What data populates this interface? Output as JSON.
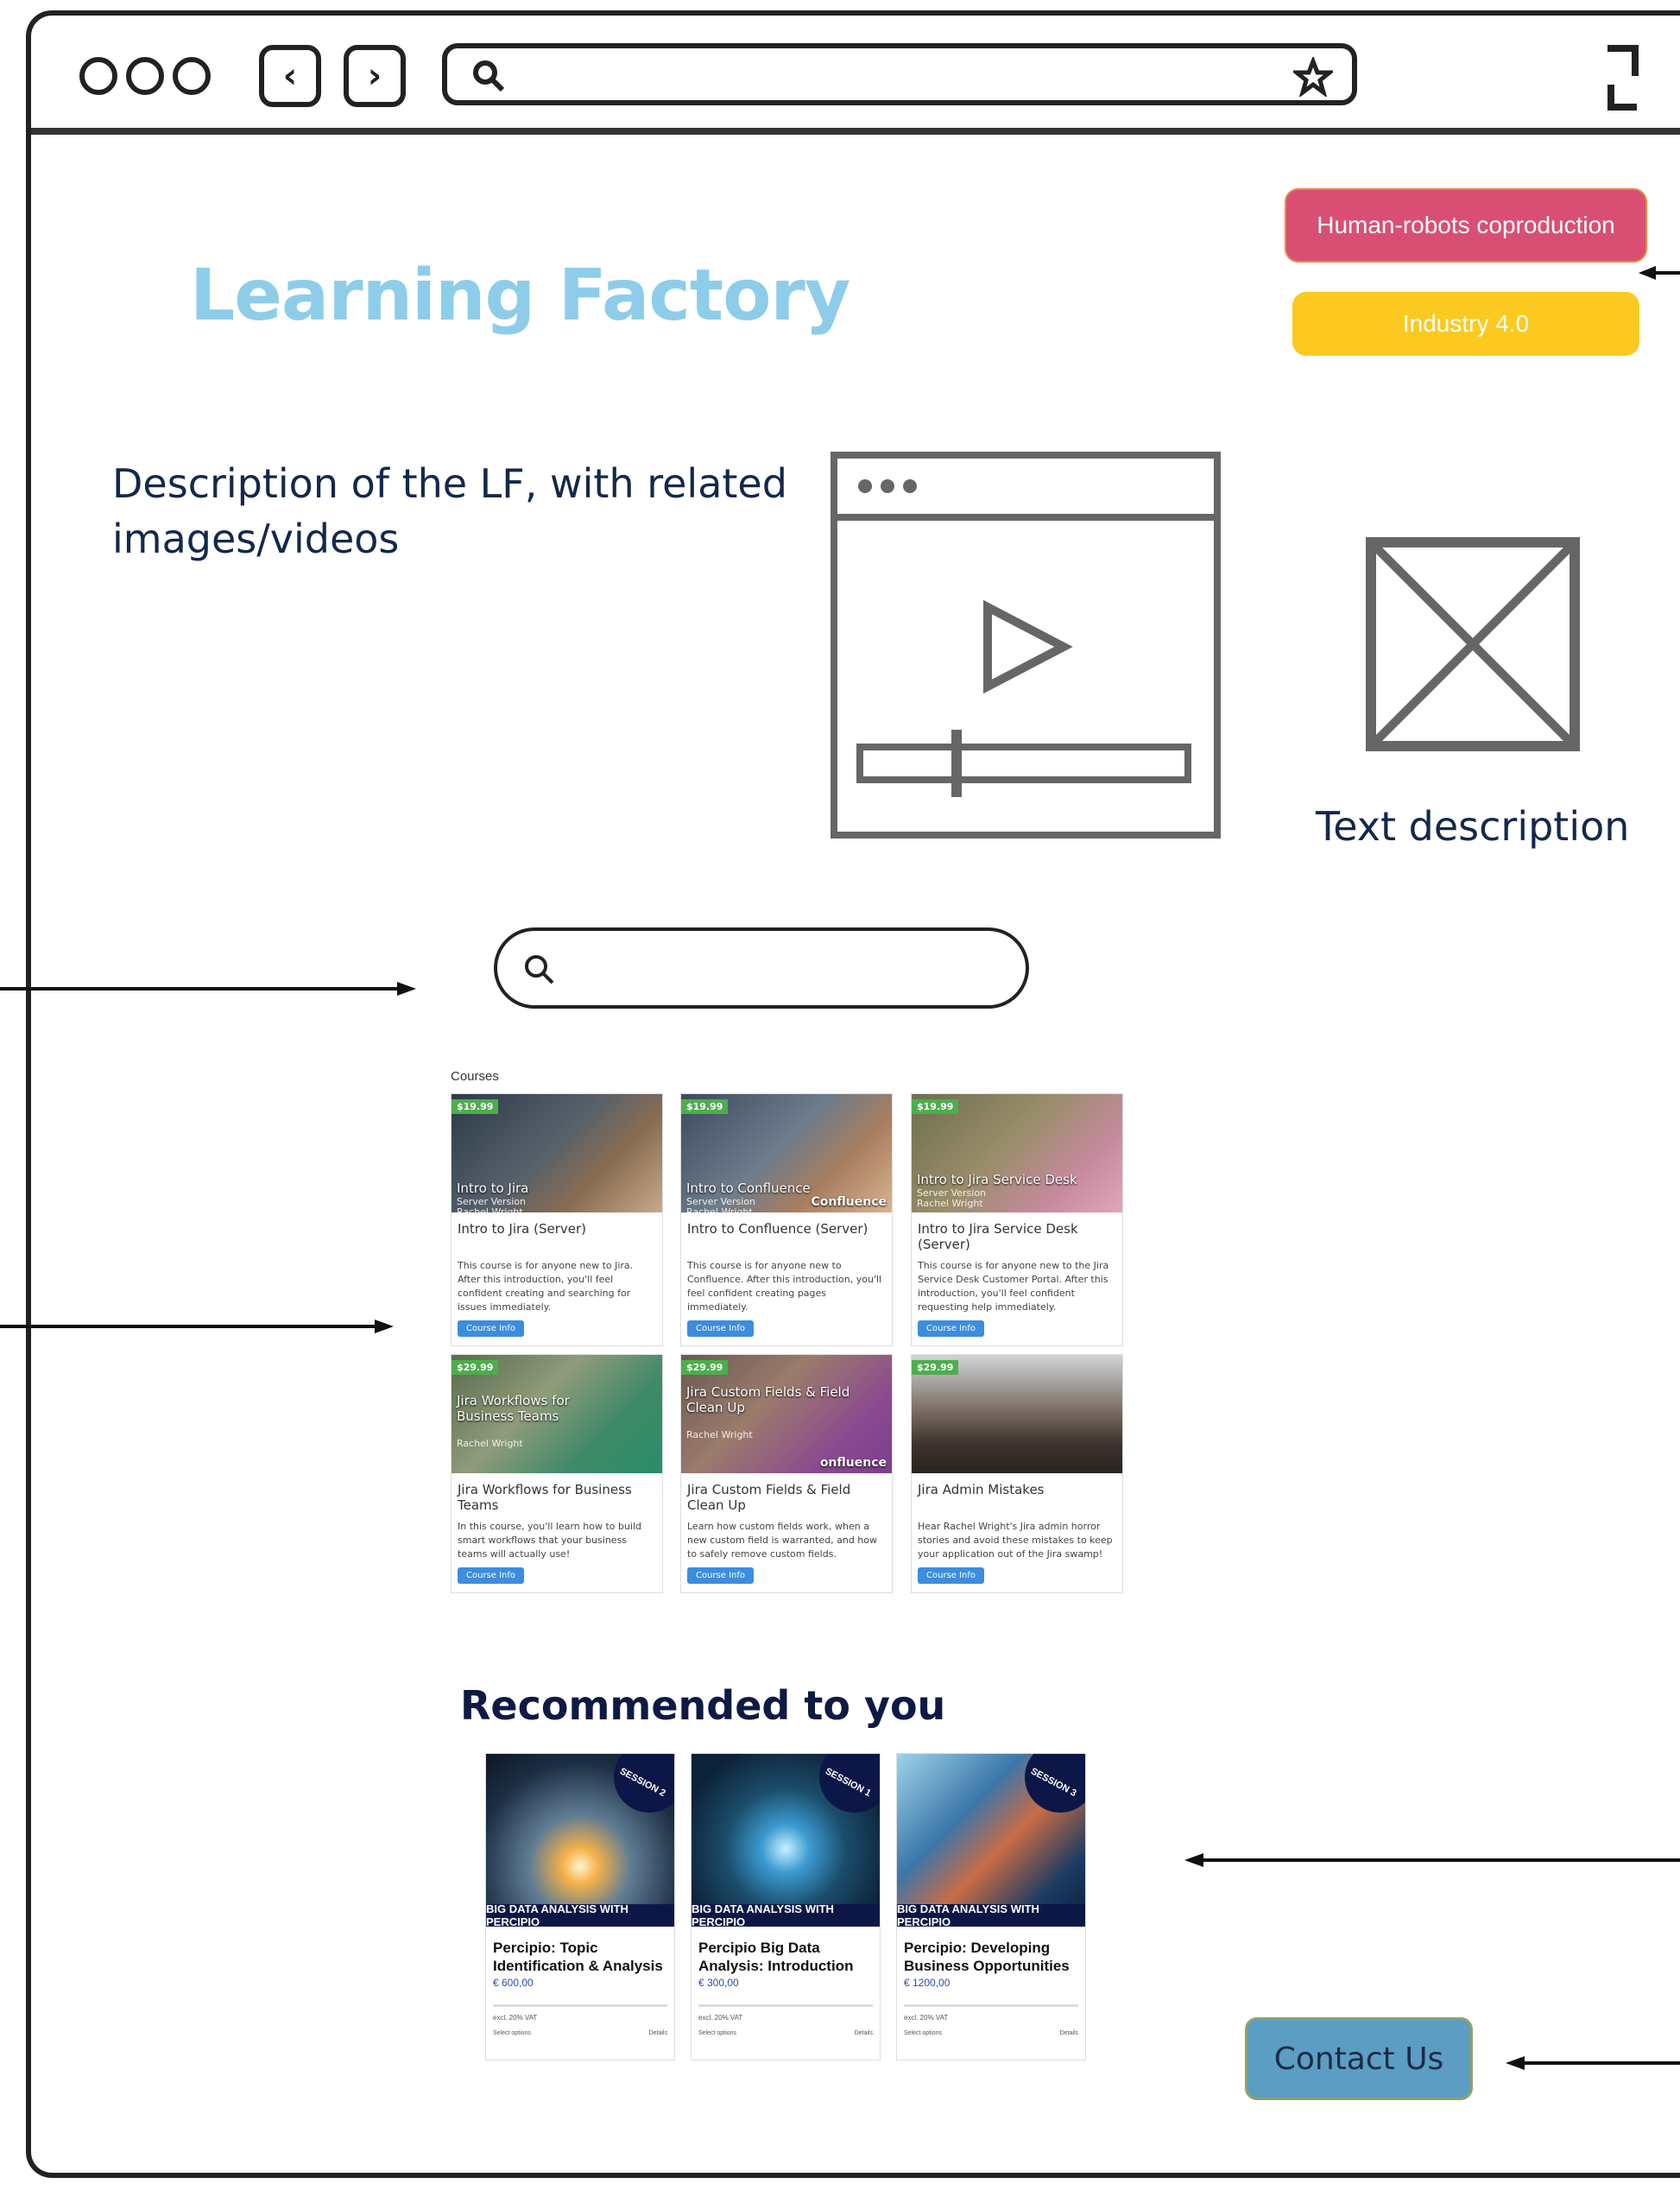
{
  "browser": {
    "icons": [
      "window-controls",
      "back-icon",
      "forward-icon",
      "search-icon",
      "bookmark-star-icon",
      "fullscreen-icon"
    ]
  },
  "header": {
    "title": "Learning Factory",
    "tags": [
      {
        "label": "Human-robots coproduction",
        "color": "#d94f74"
      },
      {
        "label": "Industry 4.0",
        "color": "#fcc920"
      }
    ]
  },
  "description": {
    "text": "Description of the LF, with related images/videos",
    "image_caption": "Text description"
  },
  "courses": {
    "label": "Courses",
    "items": [
      {
        "price": "$19.99",
        "thumb_title": "Intro to Jira",
        "thumb_sub1": "Server Version",
        "thumb_sub2": "Rachel Wright",
        "title": "Intro to Jira (Server)",
        "desc": "This course is for anyone new to Jira. After this introduction, you'll feel confident creating and searching for issues immediately.",
        "button": "Course Info"
      },
      {
        "price": "$19.99",
        "thumb_title": "Intro to Confluence",
        "thumb_sub1": "Server Version",
        "thumb_sub2": "Rachel Wright",
        "thumb_logo": "Confluence",
        "title": "Intro to Confluence (Server)",
        "desc": "This course is for anyone new to Confluence. After this introduction, you'll feel confident creating pages immediately.",
        "button": "Course Info"
      },
      {
        "price": "$19.99",
        "thumb_title": "Intro to Jira Service Desk",
        "thumb_sub1": "Server Version",
        "thumb_sub2": "Rachel Wright",
        "title": "Intro to Jira Service Desk (Server)",
        "desc": "This course is for anyone new to the Jira Service Desk Customer Portal. After this introduction, you'll feel confident requesting help immediately.",
        "button": "Course Info"
      },
      {
        "price": "$29.99",
        "thumb_title": "Jira Workflows for Business Teams",
        "thumb_sub1": "",
        "thumb_sub2": "Rachel Wright",
        "title": "Jira Workflows for Business Teams",
        "desc": "In this course, you'll learn how to build smart workflows that your business teams will actually use!",
        "button": "Course Info"
      },
      {
        "price": "$29.99",
        "thumb_title": "Jira Custom Fields & Field Clean Up",
        "thumb_sub1": "",
        "thumb_sub2": "Rachel Wright",
        "thumb_logo": "onfluence",
        "title": "Jira Custom Fields & Field Clean Up",
        "desc": "Learn how custom fields work, when a new custom field is warranted, and how to safely remove custom fields.",
        "button": "Course Info"
      },
      {
        "price": "$29.99",
        "thumb_title": "",
        "thumb_sub1": "",
        "thumb_sub2": "",
        "title": "Jira Admin Mistakes",
        "desc": "Hear Rachel Wright's Jira admin horror stories and avoid these mistakes to keep your application out of the Jira swamp!",
        "button": "Course Info"
      }
    ]
  },
  "recommended": {
    "title": "Recommended to you",
    "items": [
      {
        "session": "SESSION 2",
        "banner": "BIG DATA ANALYSIS WITH PERCIPIO",
        "name": "Percipio: Topic Identification & Analysis",
        "price": "€ 600,00",
        "vat": "excl. 20% VAT",
        "select": "Select options",
        "details": "Details"
      },
      {
        "session": "SESSION 1",
        "banner": "BIG DATA ANALYSIS WITH PERCIPIO",
        "name": "Percipio Big Data Analysis: Introduction",
        "price": "€ 300,00",
        "vat": "excl. 20% VAT",
        "select": "Select options",
        "details": "Details"
      },
      {
        "session": "SESSION 3",
        "banner": "BIG DATA ANALYSIS WITH PERCIPIO",
        "name": "Percipio: Developing Business Opportunities",
        "price": "€ 1200,00",
        "vat": "excl. 20% VAT",
        "select": "Select options",
        "details": "Details"
      }
    ]
  },
  "contact": {
    "label": "Contact Us"
  }
}
